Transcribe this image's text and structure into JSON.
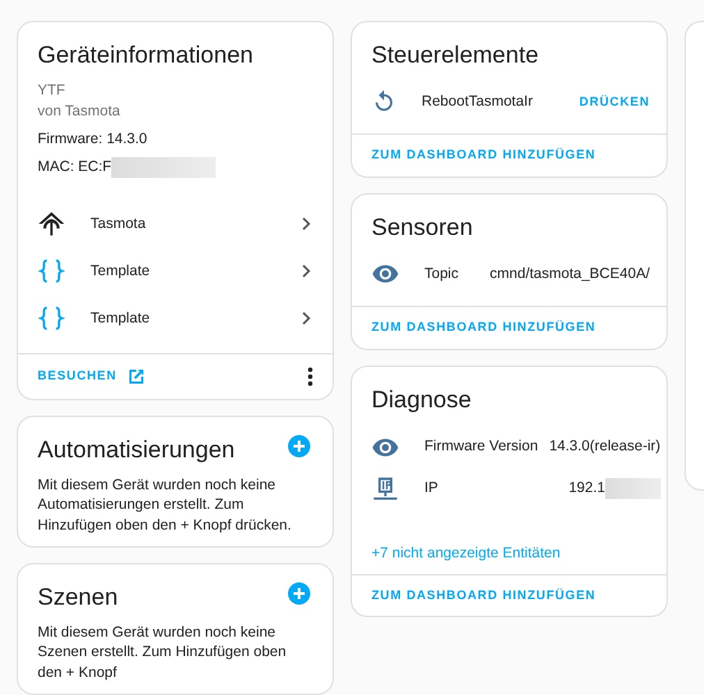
{
  "device_info": {
    "title": "Geräteinformationen",
    "model": "YTF",
    "manufacturer": "von Tasmota",
    "firmware": "Firmware: 14.3.0",
    "mac": "MAC: EC:F",
    "links": [
      {
        "kind": "tasmota",
        "label": "Tasmota"
      },
      {
        "kind": "template",
        "label": "Template"
      },
      {
        "kind": "template",
        "label": "Template"
      }
    ],
    "visit": "BESUCHEN"
  },
  "automations": {
    "title": "Automatisierungen",
    "text": "Mit diesem Gerät wurden noch keine Automatisierungen erstellt. Zum Hinzufügen oben den + Knopf drücken."
  },
  "scenes": {
    "title": "Szenen",
    "text": "Mit diesem Gerät wurden noch keine Szenen erstellt. Zum Hinzufügen oben den + Knopf"
  },
  "controls": {
    "title": "Steuerelemente",
    "entities": [
      {
        "kind": "restart",
        "name": "RebootTasmotaIr",
        "action": "DRÜCKEN"
      }
    ],
    "footer": "ZUM DASHBOARD HINZUFÜGEN"
  },
  "sensors": {
    "title": "Sensoren",
    "entities": [
      {
        "kind": "eye",
        "name": "Topic",
        "value": "cmnd/tasmota_BCE40A/"
      }
    ],
    "footer": "ZUM DASHBOARD HINZUFÜGEN"
  },
  "diagnostics": {
    "title": "Diagnose",
    "entities": [
      {
        "kind": "eye",
        "name": "Firmware Version",
        "value": "14.3.0(release-ir)"
      },
      {
        "kind": "ip",
        "name": "IP",
        "value": "192.1",
        "redacted": true
      }
    ],
    "more": "+7 nicht angezeigte Entitäten",
    "footer": "ZUM DASHBOARD HINZUFÜGEN"
  }
}
